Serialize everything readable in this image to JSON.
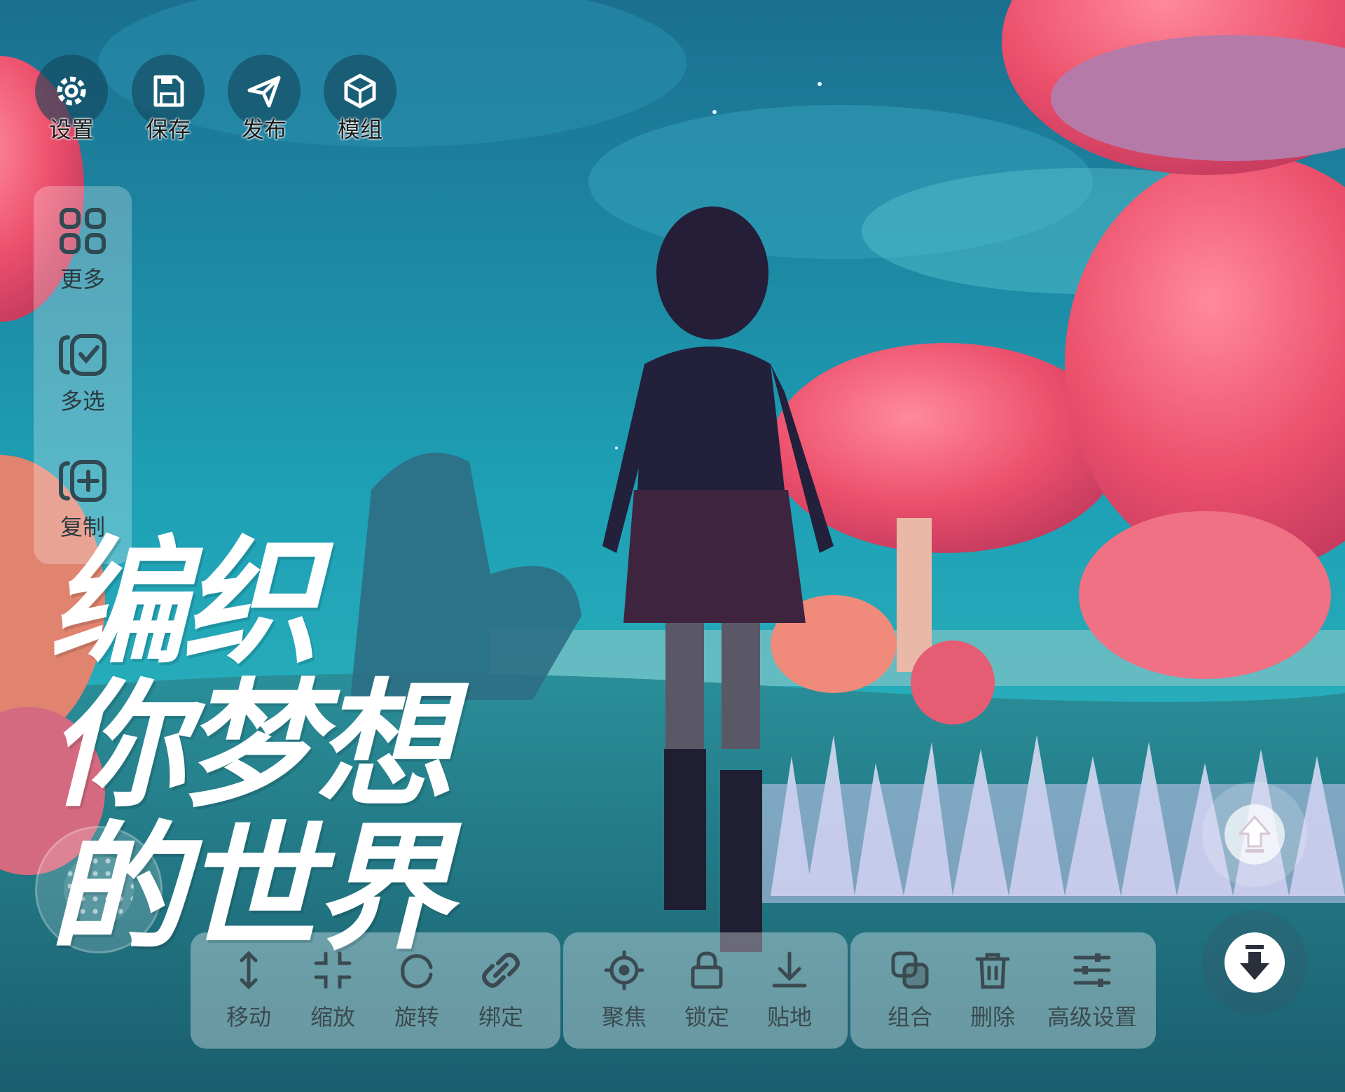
{
  "top_toolbar": {
    "settings_label": "设置",
    "save_label": "保存",
    "publish_label": "发布",
    "mods_label": "模组"
  },
  "side_panel": {
    "more_label": "更多",
    "multi_select_label": "多选",
    "copy_label": "复制"
  },
  "slogan": {
    "line1": "编织",
    "line2": "你梦想",
    "line3": "的世界"
  },
  "bottom_toolbar": {
    "transform": {
      "move_label": "移动",
      "scale_label": "缩放",
      "rotate_label": "旋转",
      "bind_label": "绑定"
    },
    "view": {
      "focus_label": "聚焦",
      "lock_label": "锁定",
      "snap_ground_label": "贴地"
    },
    "object": {
      "group_label": "组合",
      "delete_label": "删除",
      "advanced_label": "高级设置"
    }
  },
  "colors": {
    "sky": "#1e8fa6",
    "mushroom": "#ec4f6b",
    "toolbar_icon": "#2f4a52"
  }
}
